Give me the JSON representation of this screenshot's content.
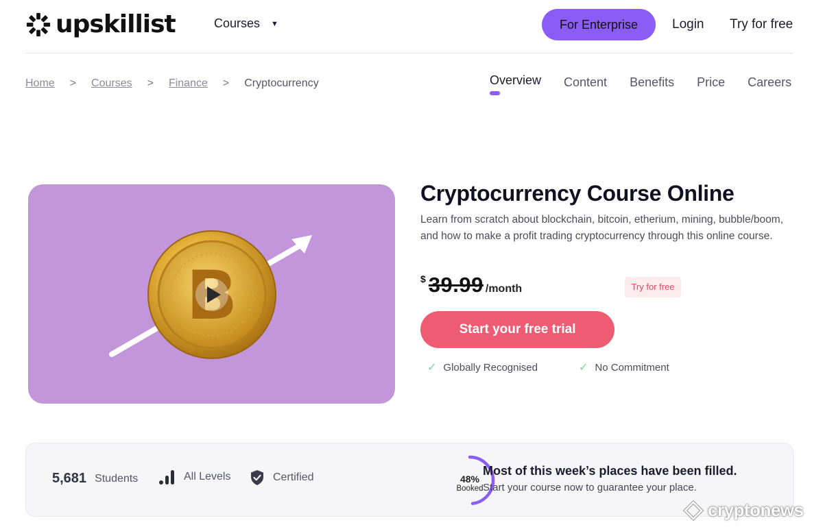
{
  "header": {
    "logo_text": "upskillist",
    "courses_label": "Courses",
    "enterprise_label": "For Enterprise",
    "login_label": "Login",
    "try_label": "Try for free"
  },
  "breadcrumb": {
    "items": [
      "Home",
      "Courses",
      "Finance"
    ],
    "current": "Cryptocurrency"
  },
  "tabs": [
    "Overview",
    "Content",
    "Benefits",
    "Price",
    "Careers"
  ],
  "course": {
    "title": "Cryptocurrency Course Online",
    "description": "Learn from scratch about blockchain, bitcoin, etherium, mining, bubble/boom, and how to make a profit trading cryptocurrency through this online course.",
    "currency": "$",
    "price": "39.99",
    "price_unit": "/month",
    "free_badge": "Try for free",
    "cta_label": "Start your free trial",
    "features": [
      "Globally Recognised",
      "No Commitment"
    ]
  },
  "stats": {
    "students_count": "5,681",
    "students_label": "Students",
    "levels_label": "All Levels",
    "certified_label": "Certified",
    "booked_percent": "48%",
    "booked_label": "Booked",
    "booked_fraction": 0.48,
    "places_title": "Most of this week’s places have been filled.",
    "places_sub": "Start your course now to guarantee your place."
  },
  "watermark": "cryptonews",
  "colors": {
    "accent_purple": "#8c5cf7",
    "cta_pink": "#ee5b72",
    "hero_bg": "#c396db",
    "check_green": "#7bd3a2"
  }
}
